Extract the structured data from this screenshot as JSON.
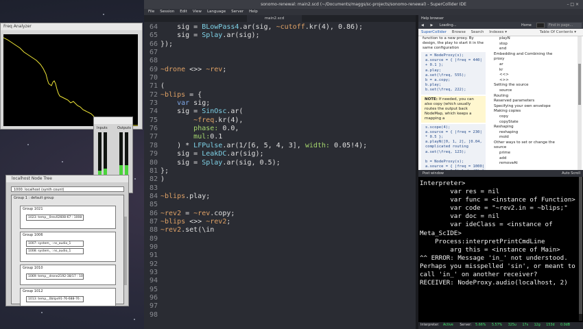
{
  "freqscope": {
    "title": "Freq Analyzer"
  },
  "meter": {
    "label_in": "Inputs",
    "label_out": "Outputs",
    "nums_in": [
      "1",
      "2"
    ],
    "nums_out": [
      "1",
      "2"
    ],
    "level_in": [
      0.3,
      0.34
    ],
    "level_out": [
      0.4,
      0.4
    ]
  },
  "nodetree": {
    "title": "localhost Node Tree",
    "server": "1000: localhost (synth count)",
    "group_label": "Group 1 : default group",
    "groups": [
      {
        "label": "Group 1021",
        "nodes": [
          "1023: temp__0rev02608-67 : 1008"
        ]
      },
      {
        "label": "Group 1006",
        "nodes": [
          "1007: system_ : ns_audio_1",
          "1008: system_ : ns_audio_1"
        ]
      },
      {
        "label": "Group 1010",
        "nodes": [
          "1069: temp__drone2192-38/17 : 1010"
        ]
      },
      {
        "label": "Group 1012",
        "nodes": [
          "1013: temp__0blips91-76-688-76 : 10"
        ]
      }
    ]
  },
  "ide": {
    "title": "sonomo-renewal: main2.scd (~/Documents/maggs/sc-projects/sonomo-renewal) - SuperCollider IDE",
    "window_controls": "– □ ×",
    "menu": [
      "File",
      "Session",
      "Edit",
      "View",
      "Language",
      "Server",
      "Help"
    ],
    "tab": "main2.scd"
  },
  "code": [
    {
      "n": "64",
      "t": [
        [
          "ct",
          "    sig = "
        ],
        [
          "cls",
          "BLowPass4"
        ],
        [
          "ct",
          ".ar(sig, "
        ],
        [
          "env",
          "~cutoff"
        ],
        [
          "ct",
          ".kr("
        ],
        [
          "num",
          "4"
        ],
        [
          "ct",
          "), "
        ],
        [
          "num",
          "0.86"
        ],
        [
          "ct",
          ");"
        ]
      ]
    },
    {
      "n": "65",
      "t": [
        [
          "ct",
          "    sig = "
        ],
        [
          "cls",
          "Splay"
        ],
        [
          "ct",
          ".ar(sig);"
        ]
      ]
    },
    {
      "n": "66",
      "t": [
        [
          "ct",
          "});"
        ]
      ]
    },
    {
      "n": "67",
      "t": []
    },
    {
      "n": "68",
      "t": []
    },
    {
      "n": "69",
      "t": [
        [
          "env",
          "~drone"
        ],
        [
          "ct",
          " <>> "
        ],
        [
          "env",
          "~rev"
        ],
        [
          "ct",
          ";"
        ]
      ]
    },
    {
      "n": "70",
      "t": []
    },
    {
      "n": "71",
      "t": [
        [
          "ct",
          "("
        ]
      ]
    },
    {
      "n": "72",
      "t": [
        [
          "env",
          "~blips"
        ],
        [
          "ct",
          " = {"
        ]
      ]
    },
    {
      "n": "73",
      "t": [
        [
          "ct",
          "    "
        ],
        [
          "kw",
          "var"
        ],
        [
          "ct",
          " sig;"
        ]
      ]
    },
    {
      "n": "74",
      "t": [
        [
          "ct",
          "    sig = "
        ],
        [
          "cls",
          "SinOsc"
        ],
        [
          "ct",
          ".ar("
        ]
      ]
    },
    {
      "n": "75",
      "t": [
        [
          "ct",
          "        "
        ],
        [
          "env",
          "~freq"
        ],
        [
          "ct",
          ".kr("
        ],
        [
          "num",
          "4"
        ],
        [
          "ct",
          "),"
        ]
      ]
    },
    {
      "n": "76",
      "t": [
        [
          "ct",
          "        "
        ],
        [
          "sym",
          "phase:"
        ],
        [
          "ct",
          " "
        ],
        [
          "num",
          "0.0"
        ],
        [
          "ct",
          ","
        ]
      ]
    },
    {
      "n": "77",
      "t": [
        [
          "ct",
          "        "
        ],
        [
          "sym",
          "mul:"
        ],
        [
          "num",
          "0.1"
        ]
      ]
    },
    {
      "n": "78",
      "t": [
        [
          "ct",
          "    ) * "
        ],
        [
          "cls",
          "LFPulse"
        ],
        [
          "ct",
          ".ar("
        ],
        [
          "num",
          "1"
        ],
        [
          "ct",
          "/["
        ],
        [
          "num",
          "6"
        ],
        [
          "ct",
          ", "
        ],
        [
          "num",
          "5"
        ],
        [
          "ct",
          ", "
        ],
        [
          "num",
          "4"
        ],
        [
          "ct",
          ", "
        ],
        [
          "num",
          "3"
        ],
        [
          "ct",
          "], "
        ],
        [
          "sym",
          "width:"
        ],
        [
          "ct",
          " "
        ],
        [
          "num",
          "0.05!4"
        ],
        [
          "ct",
          ");"
        ]
      ]
    },
    {
      "n": "79",
      "t": [
        [
          "ct",
          "    sig = "
        ],
        [
          "cls",
          "LeakDC"
        ],
        [
          "ct",
          ".ar(sig);"
        ]
      ]
    },
    {
      "n": "80",
      "t": [
        [
          "ct",
          "    sig = "
        ],
        [
          "cls",
          "Splay"
        ],
        [
          "ct",
          ".ar(sig, "
        ],
        [
          "num",
          "0.5"
        ],
        [
          "ct",
          ");"
        ]
      ]
    },
    {
      "n": "81",
      "t": [
        [
          "ct",
          "};"
        ]
      ]
    },
    {
      "n": "82",
      "t": [
        [
          "ct",
          ")"
        ]
      ]
    },
    {
      "n": "83",
      "t": []
    },
    {
      "n": "84",
      "t": [
        [
          "env",
          "~blips"
        ],
        [
          "ct",
          ".play;"
        ]
      ]
    },
    {
      "n": "85",
      "t": []
    },
    {
      "n": "86",
      "t": [
        [
          "env",
          "~rev2"
        ],
        [
          "ct",
          " = "
        ],
        [
          "env",
          "~rev"
        ],
        [
          "ct",
          ".copy;"
        ]
      ]
    },
    {
      "n": "87",
      "t": [
        [
          "env",
          "~blips"
        ],
        [
          "ct",
          " <>> "
        ],
        [
          "env",
          "~rev2"
        ],
        [
          "ct",
          ";"
        ]
      ]
    },
    {
      "n": "88",
      "t": [
        [
          "env",
          "~rev2"
        ],
        [
          "ct",
          ".set(\\in"
        ]
      ]
    },
    {
      "n": "89",
      "t": []
    },
    {
      "n": "90",
      "t": []
    },
    {
      "n": "91",
      "t": []
    },
    {
      "n": "92",
      "t": []
    },
    {
      "n": "93",
      "t": []
    },
    {
      "n": "94",
      "t": []
    },
    {
      "n": "95",
      "t": []
    },
    {
      "n": "96",
      "t": []
    },
    {
      "n": "97",
      "t": []
    },
    {
      "n": "98",
      "t": []
    }
  ],
  "help": {
    "title": "Help browser",
    "loading": "Loading...",
    "home": "Home",
    "find_placeholder": "Find in page...",
    "nav": [
      "SuperCollider",
      "Browse",
      "Search",
      "Indexes ▾"
    ],
    "toc_title": "Table Of Contents ▾",
    "intro": "function to a new proxy. By design, the play to start it in the same configuration",
    "code1": "a = NodeProxy(s);\na.source = { |freq = 440|\n+ 0.1 };\na.play;\na.set(\\freq, 555);\nb = a.copy;\nb.play;\nb.set(\\freq, 222);",
    "note_label": "NOTE:",
    "note": " If needed, you can also copy (which usually routes the output back NodeMap, which keeps a mapping a",
    "code2": "s.scope(4);\na.source = { |freq = 230|\n* 0.5 };\na.playN([0, 1, 2], [0.04,\ncomplicated routing\na.set(\\freq, 123);\n\nb = NodeProxy(s);\na.source = { |freq = 1000|\nrrand(0.9, 1.1) }.dup(8) }\nb.monitor = a.monitor.copy",
    "toc": [
      "playN",
      "stop",
      "end",
      "Embedding and Combining the",
      "proxy",
      "ar",
      "kr",
      "<<>",
      "<>>",
      "Setting the source",
      "source",
      "Routing",
      "Reserved parameters",
      "Specifying your own envelope",
      "Making copies",
      "copy",
      "copyState",
      "Reshaping",
      "reshaping",
      "mold",
      "Other ways to set or change the",
      "source",
      "prime",
      "add",
      "removeAt"
    ],
    "toc_indent": [
      2,
      2,
      2,
      1,
      1,
      2,
      2,
      2,
      2,
      1,
      2,
      1,
      1,
      1,
      1,
      2,
      2,
      1,
      2,
      2,
      1,
      1,
      2,
      2,
      2
    ]
  },
  "post": {
    "title": "Post window",
    "autoscroll": "Auto Scroll",
    "lines": [
      "Interpreter>",
      "        var res = nil",
      "        var func = <instance of Function>",
      "        var code = \"~rev2.in = ~blips;\"",
      "        var doc = nil",
      "        var ideClass = <instance of",
      "Meta_ScIDE>",
      "    Process:interpretPrintCmdLine",
      "        arg this = <instance of Main>",
      "^^ ERROR: Message 'in_' not understood.",
      "Perhaps you misspelled 'sin', or meant to",
      "call 'in_' on another receiver?",
      "RECEIVER: NodeProxy.audio(localhost, 2)"
    ]
  },
  "status": {
    "interpreter_label": "Interpreter:",
    "interpreter_state": "Active",
    "server_label": "Server:",
    "values": [
      "5.66%",
      "5.57%",
      "325u",
      "17s",
      "12g",
      "153d",
      "0.0dB"
    ]
  },
  "colors": {
    "active": "#3ee86a",
    "meter_green": "#4cd43c",
    "editor_bg": "#2a2c33"
  }
}
